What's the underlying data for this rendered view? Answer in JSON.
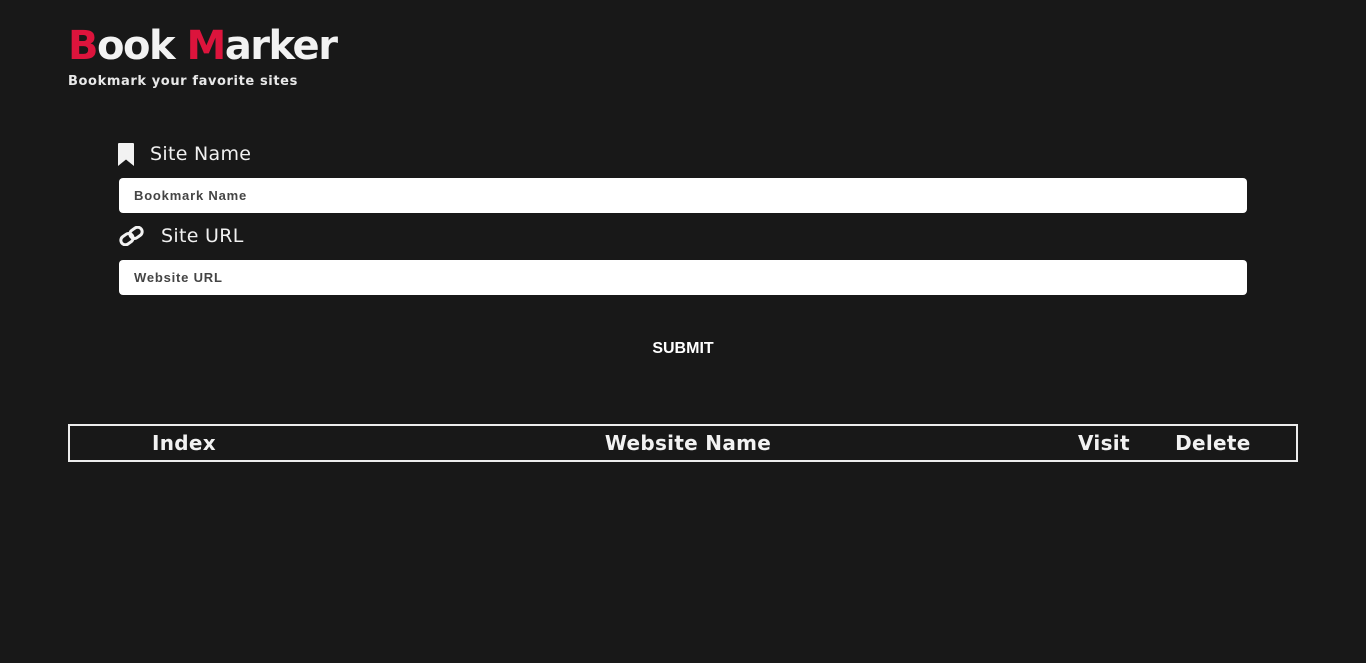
{
  "brand": {
    "title_first_initial": "B",
    "title_first_rest": "ook ",
    "title_second_initial": "M",
    "title_second_rest": "arker",
    "tagline": "Bookmark your favorite sites",
    "accent_color": "#dc143c"
  },
  "form": {
    "site_name": {
      "label": "Site Name",
      "icon": "bookmark-icon",
      "placeholder": "Bookmark Name",
      "value": ""
    },
    "site_url": {
      "label": "Site URL",
      "icon": "link-icon",
      "placeholder": "Website URL",
      "value": ""
    },
    "submit_label": "SUBMIT"
  },
  "table": {
    "headers": [
      "Index",
      "Website Name",
      "Visit",
      "Delete"
    ],
    "rows": []
  },
  "colors": {
    "background": "#181818",
    "text": "#f2f2f2",
    "input_background": "#ffffff"
  }
}
